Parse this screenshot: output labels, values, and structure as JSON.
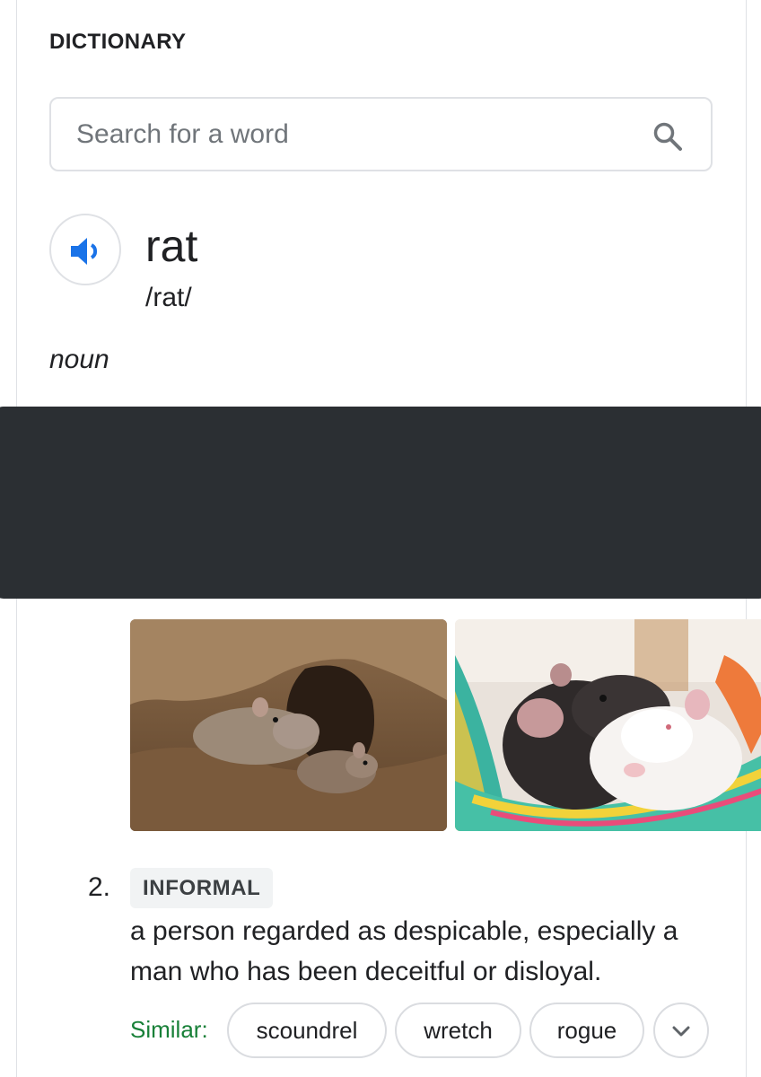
{
  "heading": "DICTIONARY",
  "search": {
    "placeholder": "Search for a word",
    "value": ""
  },
  "entry": {
    "word": "rat",
    "phonetic": "/rat/",
    "part_of_speech": "noun"
  },
  "images": [
    {
      "icon": "brown-rats-in-burrow-image"
    },
    {
      "icon": "pet-rats-in-hammock-image"
    }
  ],
  "sense": {
    "number": "2.",
    "label": "INFORMAL",
    "definition": "a person regarded as despicable, especially a man who has been deceitful or disloyal."
  },
  "similar": {
    "label": "Similar:",
    "words": [
      "scoundrel",
      "wretch",
      "rogue"
    ]
  },
  "colors": {
    "accent_blue": "#1a73e8",
    "similar_green": "#188038",
    "redaction": "#2b2f33"
  }
}
